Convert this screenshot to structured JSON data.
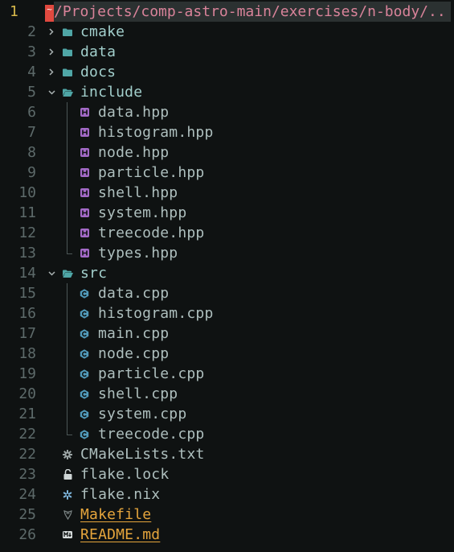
{
  "header": {
    "line_number": "1",
    "cursor_char": "~",
    "path": "/Projects/comp-astro-main/exercises/n-body/.."
  },
  "colors": {
    "background": "#0f1212",
    "folder_icon": "#4fa6a6",
    "hpp_icon": "#a36ac7",
    "cpp_icon": "#519aba",
    "highlight_file": "#e5a53c",
    "cursor": "#e0493f",
    "path_text": "#d9839a"
  },
  "tree": [
    {
      "line": "2",
      "name": "cmake",
      "kind": "dir",
      "open": false,
      "depth": 1,
      "icon": "folder-icon"
    },
    {
      "line": "3",
      "name": "data",
      "kind": "dir",
      "open": false,
      "depth": 1,
      "icon": "folder-icon"
    },
    {
      "line": "4",
      "name": "docs",
      "kind": "dir",
      "open": false,
      "depth": 1,
      "icon": "folder-icon"
    },
    {
      "line": "5",
      "name": "include",
      "kind": "dir",
      "open": true,
      "depth": 1,
      "icon": "folder-open-icon"
    },
    {
      "line": "6",
      "name": "data.hpp",
      "kind": "file",
      "depth": 2,
      "icon": "hpp-file-icon"
    },
    {
      "line": "7",
      "name": "histogram.hpp",
      "kind": "file",
      "depth": 2,
      "icon": "hpp-file-icon"
    },
    {
      "line": "8",
      "name": "node.hpp",
      "kind": "file",
      "depth": 2,
      "icon": "hpp-file-icon"
    },
    {
      "line": "9",
      "name": "particle.hpp",
      "kind": "file",
      "depth": 2,
      "icon": "hpp-file-icon"
    },
    {
      "line": "10",
      "name": "shell.hpp",
      "kind": "file",
      "depth": 2,
      "icon": "hpp-file-icon"
    },
    {
      "line": "11",
      "name": "system.hpp",
      "kind": "file",
      "depth": 2,
      "icon": "hpp-file-icon"
    },
    {
      "line": "12",
      "name": "treecode.hpp",
      "kind": "file",
      "depth": 2,
      "icon": "hpp-file-icon"
    },
    {
      "line": "13",
      "name": "types.hpp",
      "kind": "file",
      "depth": 2,
      "icon": "hpp-file-icon",
      "last": true
    },
    {
      "line": "14",
      "name": "src",
      "kind": "dir",
      "open": true,
      "depth": 1,
      "icon": "folder-open-icon"
    },
    {
      "line": "15",
      "name": "data.cpp",
      "kind": "file",
      "depth": 2,
      "icon": "cpp-file-icon"
    },
    {
      "line": "16",
      "name": "histogram.cpp",
      "kind": "file",
      "depth": 2,
      "icon": "cpp-file-icon"
    },
    {
      "line": "17",
      "name": "main.cpp",
      "kind": "file",
      "depth": 2,
      "icon": "cpp-file-icon"
    },
    {
      "line": "18",
      "name": "node.cpp",
      "kind": "file",
      "depth": 2,
      "icon": "cpp-file-icon"
    },
    {
      "line": "19",
      "name": "particle.cpp",
      "kind": "file",
      "depth": 2,
      "icon": "cpp-file-icon"
    },
    {
      "line": "20",
      "name": "shell.cpp",
      "kind": "file",
      "depth": 2,
      "icon": "cpp-file-icon"
    },
    {
      "line": "21",
      "name": "system.cpp",
      "kind": "file",
      "depth": 2,
      "icon": "cpp-file-icon"
    },
    {
      "line": "22",
      "name": "treecode.cpp",
      "kind": "file",
      "depth": 2,
      "icon": "cpp-file-icon",
      "last": true
    },
    {
      "line": "22",
      "name": "CMakeLists.txt",
      "kind": "file",
      "depth": 1,
      "icon": "gear-icon"
    },
    {
      "line": "23",
      "name": "flake.lock",
      "kind": "file",
      "depth": 1,
      "icon": "lock-icon"
    },
    {
      "line": "24",
      "name": "flake.nix",
      "kind": "file",
      "depth": 1,
      "icon": "nix-snowflake-icon"
    },
    {
      "line": "25",
      "name": "Makefile",
      "kind": "file",
      "depth": 1,
      "icon": "makefile-icon",
      "highlight": true
    },
    {
      "line": "26",
      "name": "README.md",
      "kind": "file",
      "depth": 1,
      "icon": "markdown-icon",
      "highlight": true
    }
  ]
}
